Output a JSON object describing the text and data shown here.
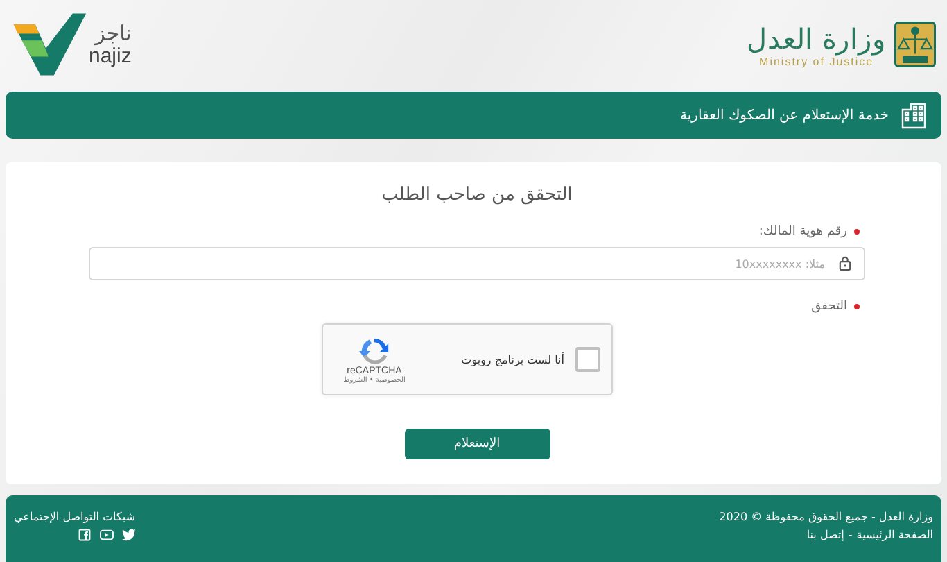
{
  "header": {
    "ministry": {
      "name": "وزارة العدل",
      "subtitle": "Ministry of Justice"
    },
    "najiz": {
      "name_ar": "ناجز",
      "name_en": "najiz"
    }
  },
  "service_bar": {
    "title": "خدمة الإستعلام عن الصكوك العقارية"
  },
  "form": {
    "title": "التحقق من صاحب الطلب",
    "fields": [
      {
        "label": "رقم هوية المالك:",
        "required": true,
        "placeholder": "مثلا: 10xxxxxxxx"
      }
    ],
    "captcha": {
      "label": "التحقق",
      "required": true,
      "checkbox_label": "أنا لست برنامج روبوت",
      "checked": false,
      "brand": "reCAPTCHA",
      "terms": "الخصوصية • الشروط"
    },
    "submit": "الإستعلام"
  },
  "footer": {
    "copyright": "وزارة العدل - جميع الحقوق محفوظة © 2020",
    "links": [
      "الصفحة الرئيسية",
      "إتصل بنا"
    ],
    "separator": "-",
    "social_title": "شبكات التواصل الإجتماعي",
    "social": [
      {
        "kind": "twitter"
      },
      {
        "kind": "youtube"
      },
      {
        "kind": "facebook"
      }
    ]
  }
}
